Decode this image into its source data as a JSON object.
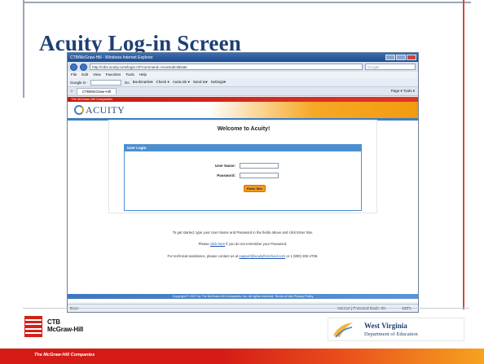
{
  "slide": {
    "title": "Acuity Log-in Screen"
  },
  "browser": {
    "window_title": "CTB/McGraw-Hill - Windows Internet Explorer",
    "address": "http://ctb2.acuity.com/login.ml?command=ArvoSubmitDate",
    "search_placeholder": "Google",
    "menu": [
      "File",
      "Edit",
      "View",
      "Favorites",
      "Tools",
      "Help"
    ],
    "toolbar": {
      "google_label": "Google G-",
      "go_label": "Go",
      "bookmarks": "Bookmarks▾",
      "check": "Check ▾",
      "autolink": "AutoLink ▾",
      "sendto": "Send to▾",
      "settings": "Settings▾"
    },
    "tab_label": "CTB/McGraw-Hill",
    "tab_tools": "Page ▾  Tools ▾",
    "status_left": "Done",
    "status_zone": "Internet | Protected Mode: On",
    "status_zoom": "100%"
  },
  "page": {
    "vendor": "The McGraw-Hill Companies",
    "logo": "ACUITY",
    "welcome": "Welcome to Acuity!",
    "login_header": "User Login",
    "username_label": "User Name:",
    "password_label": "Password:",
    "enter_button": "Enter Site",
    "info1": "To get started, type your User Name and Password in the fields above and click Enter Site.",
    "info2_pre": "Please ",
    "info2_link": "click here",
    "info2_post": " if you do not remember your Password.",
    "info3_pre": "For technical assistance, please contact us at ",
    "info3_link": "support@acuityforschool.com",
    "info3_post": " or 1 (800) 282-4705.",
    "footer": "Copyright © 2007 by The McGraw-Hill Companies, Inc. All rights reserved. Terms of Use  Privacy Policy"
  },
  "footer": {
    "ctb_line1": "CTB",
    "ctb_line2": "McGraw-Hill",
    "wv_title": "West Virginia",
    "wv_sub": "Department of Education",
    "company": "The McGraw-Hill Companies"
  },
  "colors": {
    "title": "#1f3f74",
    "accent_orange": "#f39b10",
    "brand_blue": "#3f7fc2",
    "red": "#d41b15"
  }
}
